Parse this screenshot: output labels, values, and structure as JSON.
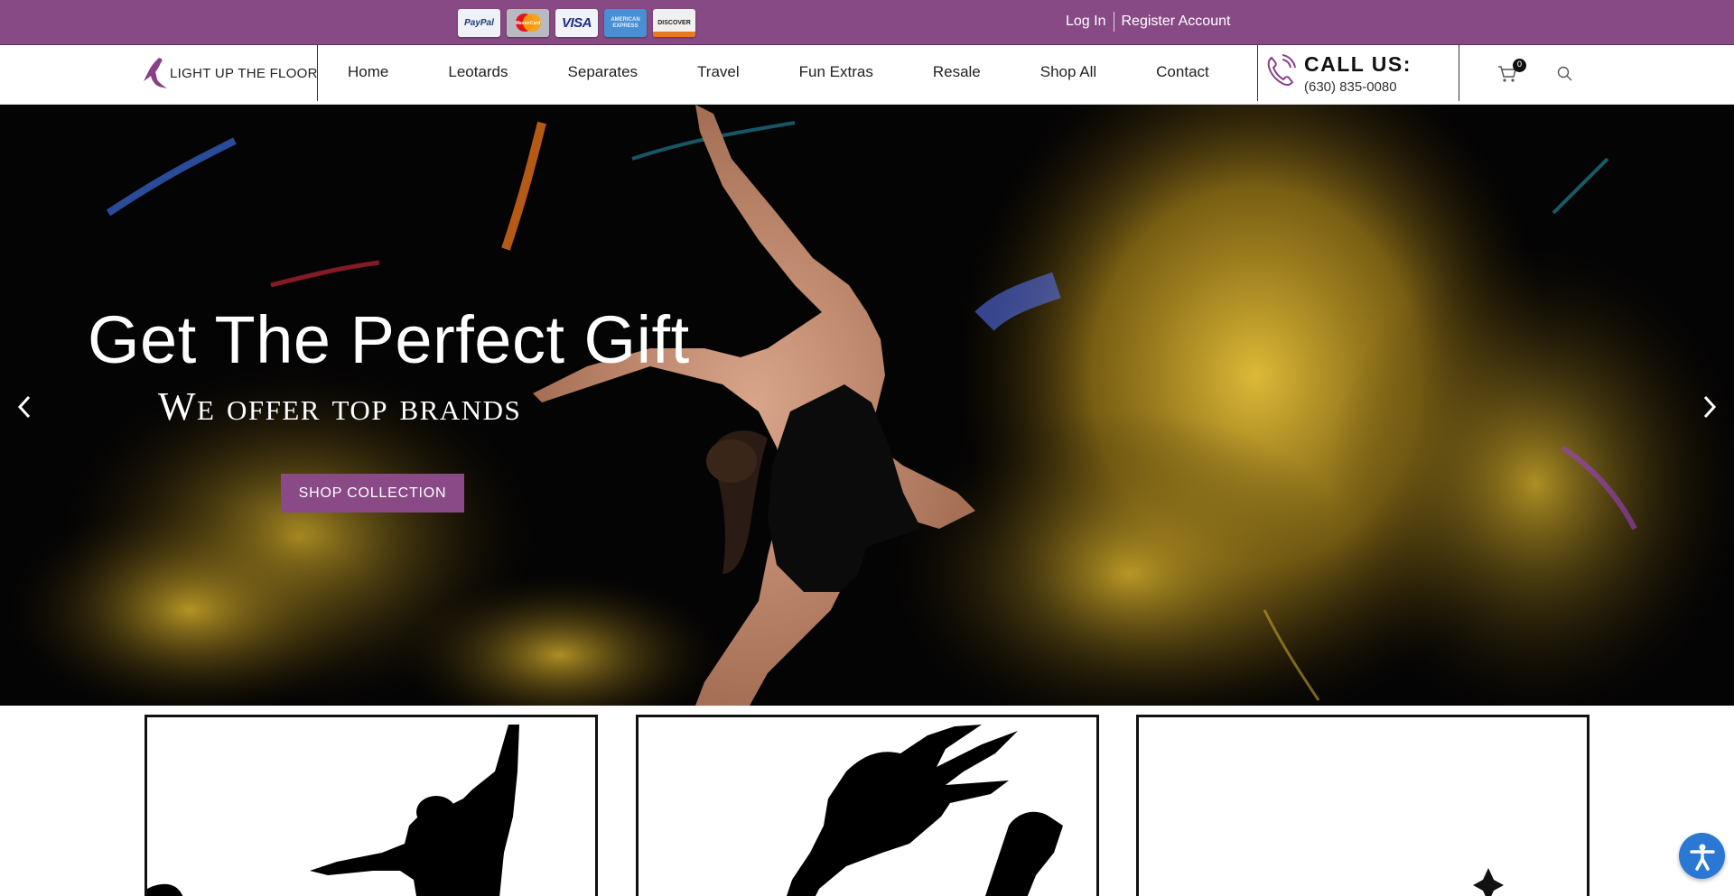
{
  "colors": {
    "topbar": "#884a85",
    "accent_button": "#8a4a87",
    "accessibility": "#2a78d3"
  },
  "topbar": {
    "payment_icons": [
      "paypal-icon",
      "mastercard-icon",
      "visa-icon",
      "american-express-icon",
      "discover-icon"
    ],
    "paypal_text": "PayPal",
    "mastercard_text": "MasterCard",
    "visa_text": "VISA",
    "amex_text": "AMERICAN EXPRESS",
    "discover_text": "DISCOVER",
    "login_label": "Log In",
    "register_label": "Register Account"
  },
  "header": {
    "logo_text": "LIGHT UP THE FLOOR",
    "nav": [
      {
        "label": "Home"
      },
      {
        "label": "Leotards"
      },
      {
        "label": "Separates"
      },
      {
        "label": "Travel"
      },
      {
        "label": "Fun Extras"
      },
      {
        "label": "Resale"
      },
      {
        "label": "Shop All"
      },
      {
        "label": "Contact"
      }
    ],
    "call_title": "CALL US:",
    "call_phone": "(630) 835-0080",
    "cart_count": "0"
  },
  "hero": {
    "title": "Get The Perfect Gift",
    "subtitle": "We offer top brands",
    "button_label": "SHOP COLLECTION"
  }
}
